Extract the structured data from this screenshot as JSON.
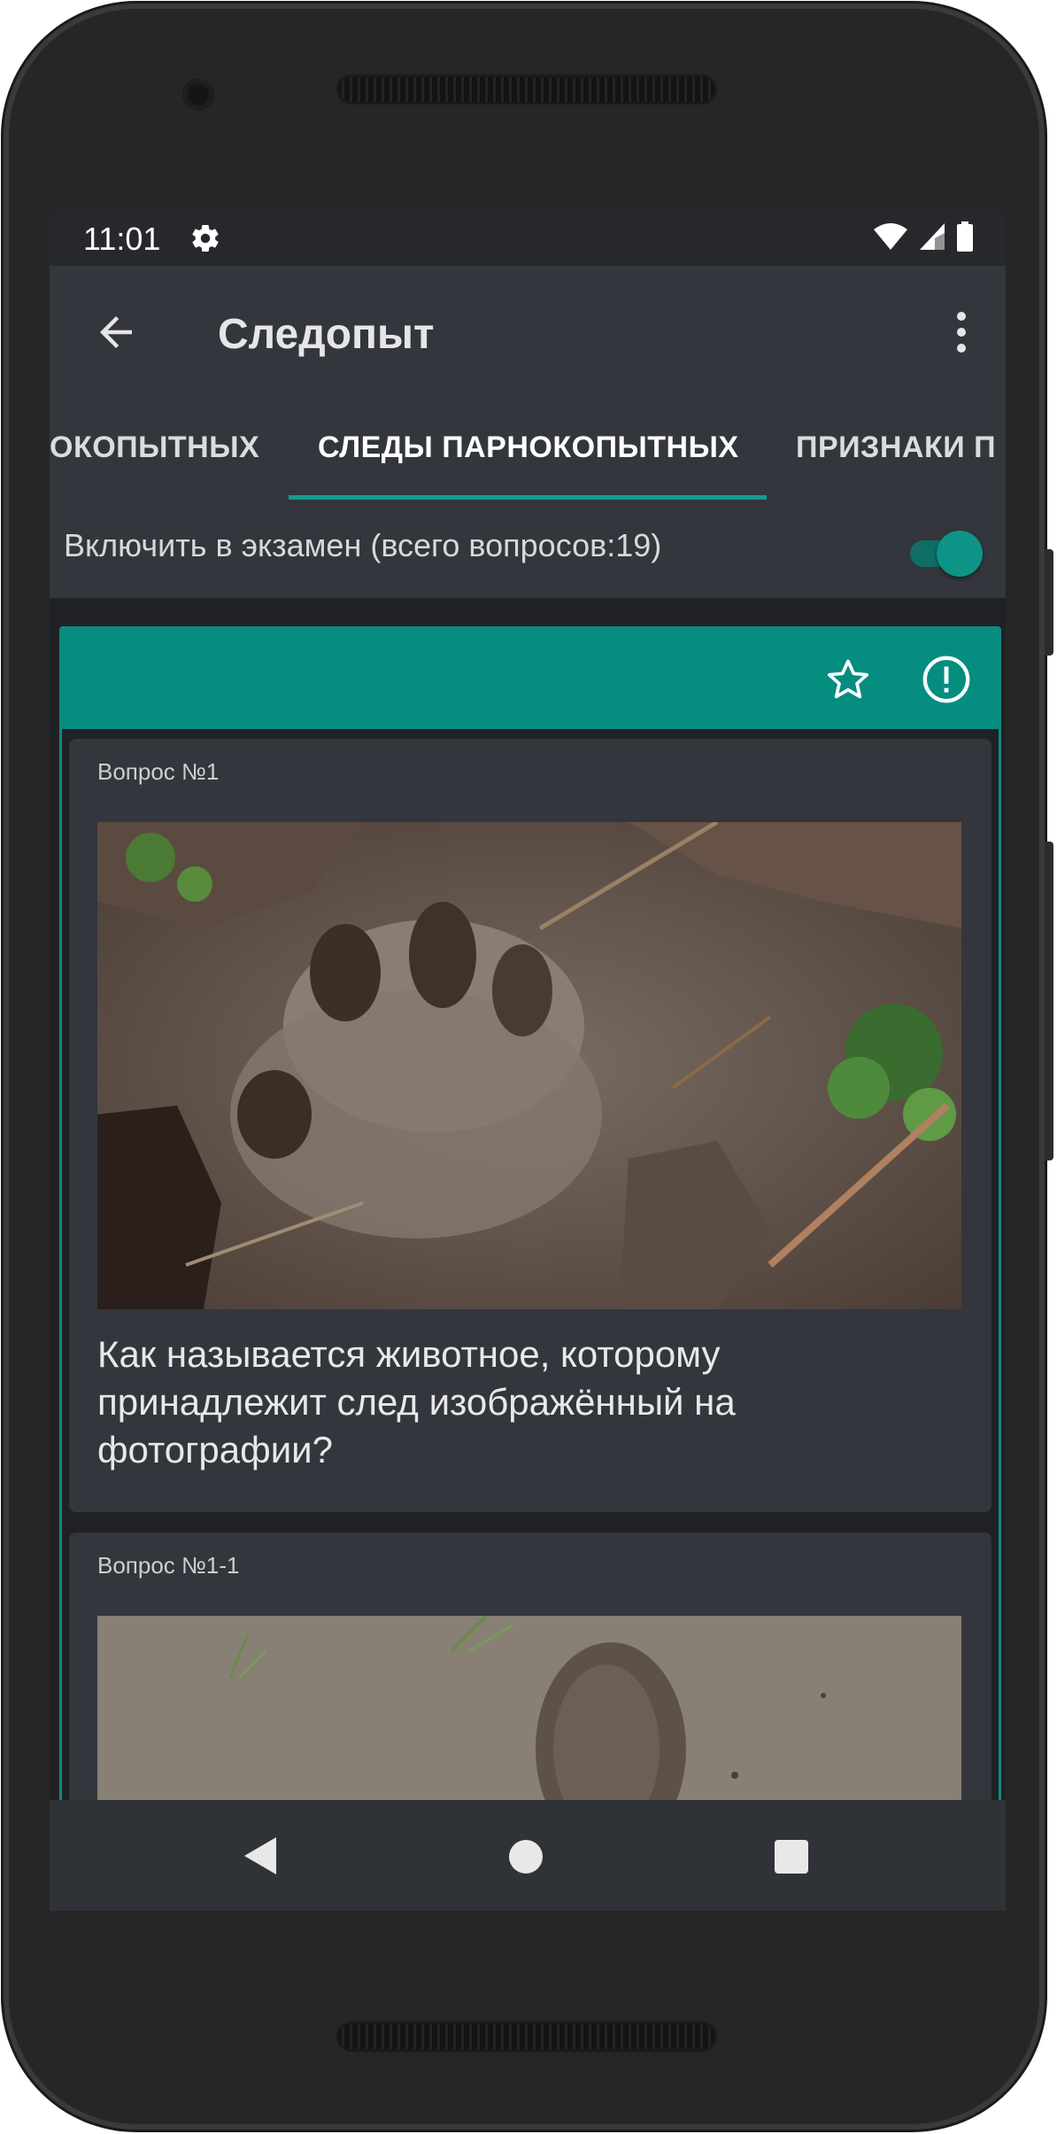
{
  "status_bar": {
    "time": "11:01",
    "settings_icon": "gear-icon",
    "wifi_icon": "wifi-icon",
    "signal_icon": "signal-icon",
    "battery_icon": "battery-icon"
  },
  "app_bar": {
    "title": "Следопыт",
    "back_icon": "arrow-left-icon",
    "menu_icon": "more-vert-icon"
  },
  "tabs": [
    {
      "label": "ОКОПЫТНЫХ",
      "selected": false
    },
    {
      "label": "СЛЕДЫ ПАРНОКОПЫТНЫХ",
      "selected": true
    },
    {
      "label": "ПРИЗНАКИ П",
      "selected": false
    }
  ],
  "exam_toggle": {
    "label": "Включить в экзамен (всего вопросов:19)",
    "enabled": true
  },
  "card_header": {
    "favorite_icon": "star-outline-icon",
    "report_icon": "alert-circle-icon"
  },
  "questions": [
    {
      "number": "Вопрос №1",
      "text": "Как называется животное, которому принадлежит след изображённый на фотографии?"
    },
    {
      "number": "Вопрос №1-1",
      "text": ""
    }
  ],
  "nav_bar": {
    "back_icon": "nav-back-icon",
    "home_icon": "nav-home-icon",
    "recents_icon": "nav-recents-icon"
  },
  "colors": {
    "accent": "#058d80",
    "surface": "#33363c",
    "background": "#202125"
  }
}
